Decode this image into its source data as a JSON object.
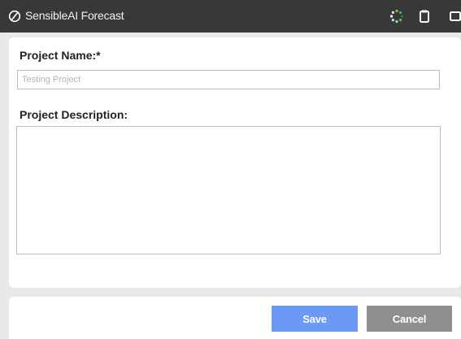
{
  "titlebar": {
    "app_title": "SensibleAI Forecast",
    "logo_icon": "slashed-circle-logo-icon",
    "icons": [
      "loading-spinner-icon",
      "window-icon",
      "window-icon"
    ]
  },
  "form": {
    "name_label": "Project Name:*",
    "name_placeholder": "Testing Project",
    "name_value": "",
    "description_label": "Project Description:",
    "description_value": ""
  },
  "buttons": {
    "save_label": "Save",
    "cancel_label": "Cancel"
  },
  "colors": {
    "titlebar": "#383838",
    "save": "#6b99f4",
    "cancel": "#8f8f8f",
    "spinner": "#4caf50"
  }
}
